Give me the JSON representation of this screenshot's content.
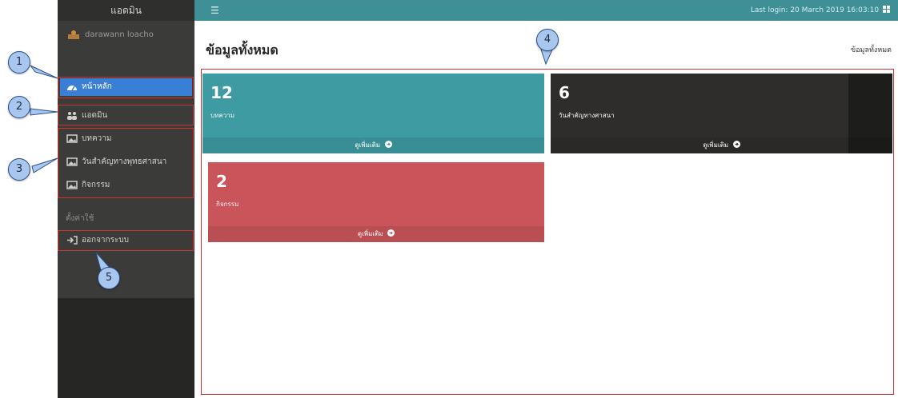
{
  "sidebar": {
    "brand": "แอดมิน",
    "user_name": "darawann loacho",
    "items": [
      {
        "label": "หน้าหลัก",
        "active": true
      },
      {
        "label": "แอดมิน"
      },
      {
        "label": "บทความ"
      },
      {
        "label": "วันสำคัญทางพุทธศาสนา"
      },
      {
        "label": "กิจกรรม"
      }
    ],
    "section_label": "ตั้งค่าใช้",
    "logout_label": "ออกจากระบบ"
  },
  "topbar": {
    "menu_icon": "hamburger-icon",
    "last_login": "Last login: 20 March 2019 16:03:10",
    "windows_icon": "windows-icon"
  },
  "page": {
    "title": "ข้อมูลทั้งหมด",
    "breadcrumb": "ข้อมูลทั้งหมด"
  },
  "cards": [
    {
      "count": "12",
      "label": "บทความ",
      "more": "ดูเพิ่มเติม",
      "color": "#3e9ba2"
    },
    {
      "count": "6",
      "label": "วันสำคัญทางศาสนา",
      "more": "ดูเพิ่มเติม",
      "color": "#2e2d2b"
    },
    {
      "count": "2",
      "label": "กิจกรรม",
      "more": "ดูเพิ่มเติม",
      "color": "#c9555b"
    }
  ],
  "callouts": [
    "1",
    "2",
    "3",
    "4",
    "5"
  ],
  "colors": {
    "sidebar_bg": "#3b3b39",
    "topbar_bg": "#3f8f96",
    "active_item": "#3a7fd6",
    "annotation_frame": "#d5322d",
    "callout_fill": "#a9c7ee"
  }
}
